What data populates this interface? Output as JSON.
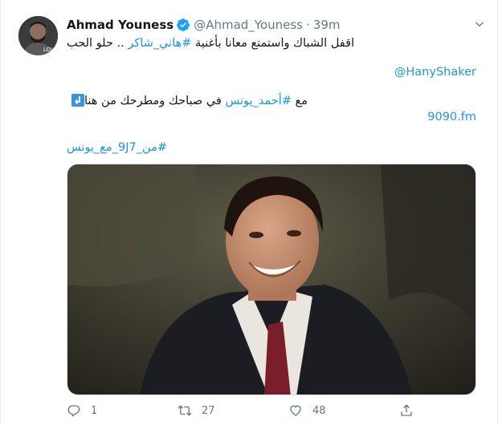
{
  "tweet": {
    "author_name": "Ahmad Youness",
    "handle": "@Ahmad_Youness",
    "separator": "·",
    "time": "39m",
    "line1_text": "اقفل الشباك واستمتع معانا بأغنية ",
    "line1_hashtag": "#هاني_شاكر",
    "line1_tail": " .. حلو الحب",
    "mention": "@HanyShaker",
    "line3_prefix": "مع ",
    "line3_hashtag": "#أحمد_يونس",
    "line3_text": " في صباحك ومطرحك من هنا",
    "link": "9090.fm",
    "hashtag_line": "#من_9J7_مع_يونس"
  },
  "actions": {
    "reply_count": "1",
    "retweet_count": "27",
    "like_count": "48"
  },
  "colors": {
    "link_blue": "#1b95e0",
    "verified_blue": "#1da1f2",
    "muted": "#657786"
  },
  "icons": [
    "avatar",
    "verified-badge-icon",
    "chevron-down-icon",
    "pointing-down-emoji-icon",
    "reply-icon",
    "retweet-icon",
    "like-icon",
    "share-icon"
  ]
}
